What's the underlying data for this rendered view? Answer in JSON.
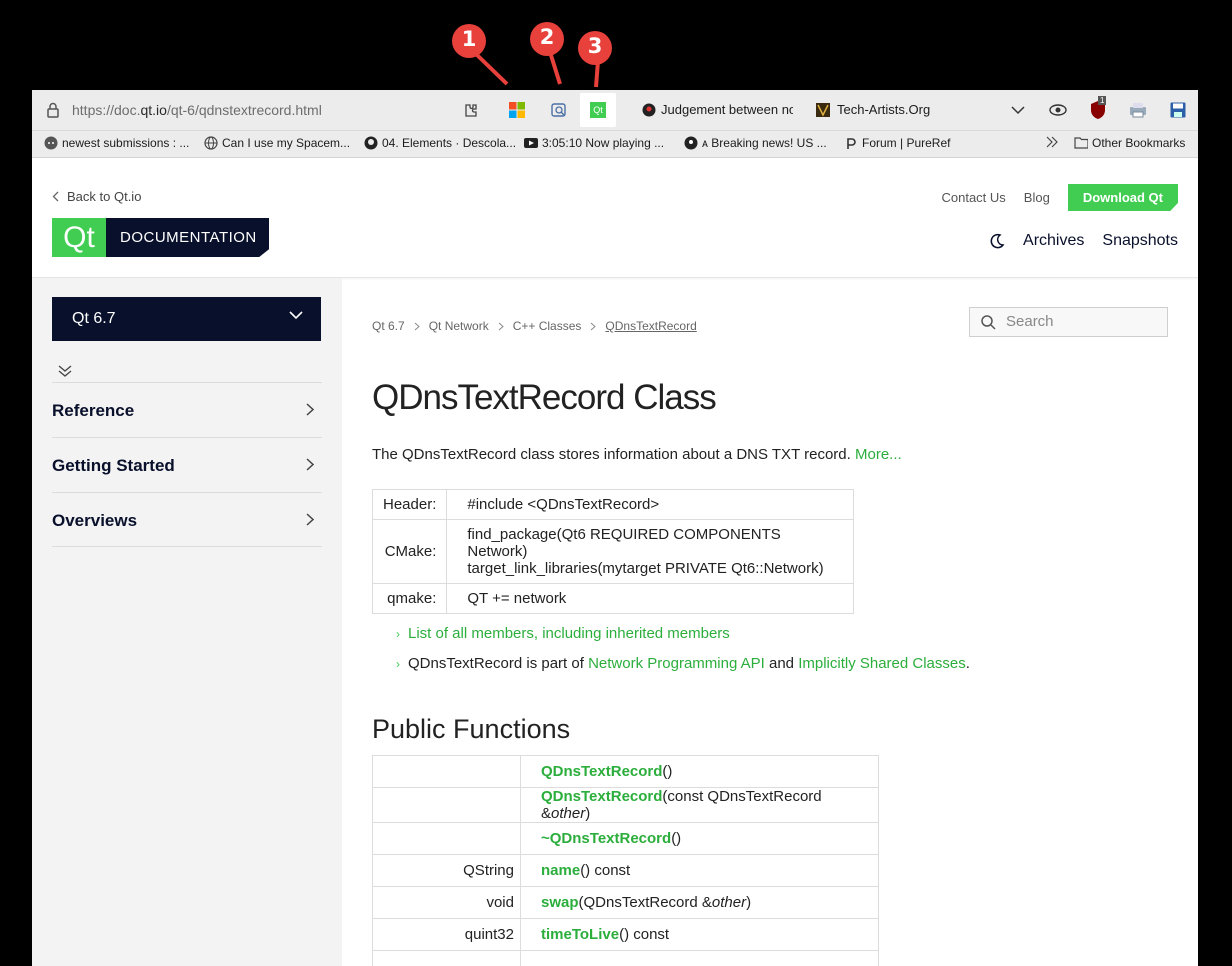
{
  "callouts": [
    "1",
    "2",
    "3"
  ],
  "urlbar": {
    "url_prefix": "https://doc.",
    "url_domain": "qt.io",
    "url_path": "/qt-6/qdnstextrecord.html",
    "pinned_tab_3_label": "Qt",
    "tabs": [
      "Judgement between non",
      "Tech-Artists.Org"
    ],
    "extension_badge": "1"
  },
  "bookmarks": {
    "items": [
      "newest submissions : ...",
      "Can I use my Spacem...",
      "04. Elements · Descola...",
      "3:05:10  Now playing  ...",
      "ᴀ Breaking news! US ...",
      "Forum | PureRef"
    ],
    "other": "Other Bookmarks"
  },
  "header": {
    "back_label": "Back to Qt.io",
    "logo_qt": "Qt",
    "logo_doc": "DOCUMENTATION",
    "contact": "Contact Us",
    "blog": "Blog",
    "download": "Download Qt",
    "archives": "Archives",
    "snapshots": "Snapshots"
  },
  "sidebar": {
    "version": "Qt 6.7",
    "items": [
      {
        "label": "Reference"
      },
      {
        "label": "Getting Started"
      },
      {
        "label": "Overviews"
      }
    ]
  },
  "content": {
    "breadcrumb": [
      "Qt 6.7",
      "Qt Network",
      "C++ Classes",
      "QDnsTextRecord"
    ],
    "search_placeholder": "Search",
    "title": "QDnsTextRecord Class",
    "brief": "The QDnsTextRecord class stores information about a DNS TXT record.",
    "more": "More...",
    "info": {
      "header_key": "Header:",
      "header_val": "#include <QDnsTextRecord>",
      "cmake_key": "CMake:",
      "cmake_val_1": "find_package(Qt6 REQUIRED COMPONENTS Network)",
      "cmake_val_2": "target_link_libraries(mytarget PRIVATE Qt6::Network)",
      "qmake_key": "qmake:",
      "qmake_val": "QT += network"
    },
    "bullet1": "List of all members, including inherited members",
    "bullet2_prefix": "QDnsTextRecord is part of",
    "bullet2_link1": "Network Programming API",
    "bullet2_and": "and",
    "bullet2_link2": "Implicitly Shared Classes",
    "bullet2_suffix": ".",
    "public_functions": "Public Functions",
    "functions": [
      {
        "type": "",
        "name": "QDnsTextRecord",
        "args": "()",
        "param": "",
        "tail": ""
      },
      {
        "type": "",
        "name": "QDnsTextRecord",
        "args": "(const QDnsTextRecord &",
        "param": "other",
        "tail": ")"
      },
      {
        "type": "",
        "name": "~QDnsTextRecord",
        "args": "()",
        "param": "",
        "tail": ""
      },
      {
        "type": "QString",
        "name": "name",
        "args": "() const",
        "param": "",
        "tail": ""
      },
      {
        "type": "void",
        "name": "swap",
        "args": "(QDnsTextRecord &",
        "param": "other",
        "tail": ")"
      },
      {
        "type": "quint32",
        "name": "timeToLive",
        "args": "() const",
        "param": "",
        "tail": ""
      },
      {
        "type": "",
        "name": "",
        "args": "",
        "param": "",
        "tail": ""
      }
    ]
  },
  "colors": {
    "qt_green": "#41cd52",
    "qt_navy": "#09102b",
    "callout_red": "#e8413b"
  }
}
